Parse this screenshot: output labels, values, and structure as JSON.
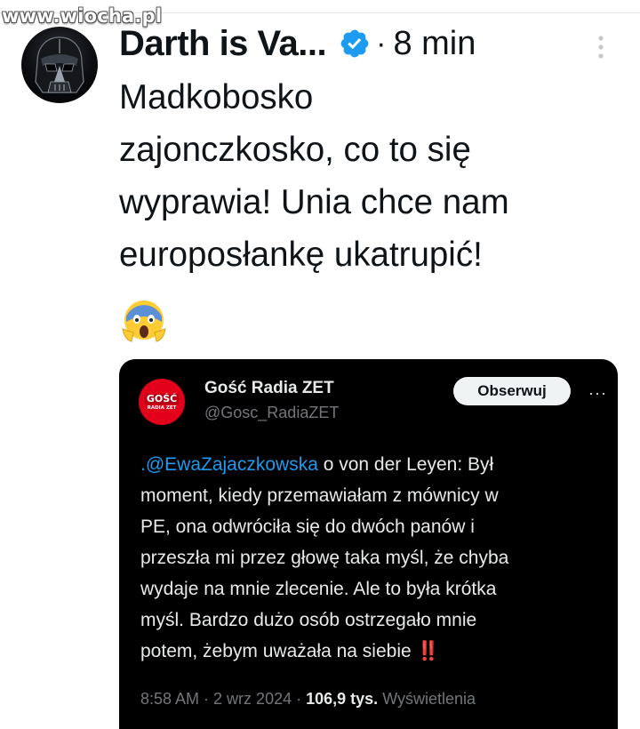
{
  "watermark": "www.wiocha.pl",
  "tweet": {
    "author_name": "Darth is Va...",
    "separator": "·",
    "time": "8 min",
    "text_lines": [
      "Madkobosko",
      "zajonczkosko, co to się",
      "wyprawia! Unia chce nam",
      "europosłankę ukatrupić!"
    ],
    "emoji": "😱"
  },
  "quoted": {
    "name": "Gość Radia ZET",
    "handle": "@Gosc_RadiaZET",
    "follow_label": "Obserwuj",
    "more": "···",
    "logo_text": "GOŚĆ",
    "logo_subtext": "RADIA ZET",
    "mention": ".@EwaZajaczkowska",
    "text_lines": [
      " o von der Leyen: Był",
      "moment, kiedy przemawiałam z mównicy w",
      "PE, ona odwróciła się do dwóch panów i",
      "przeszła mi przez głowę taka myśl, że chyba",
      "wydaje na mnie zlecenie. Ale to była krótka",
      "myśl. Bardzo dużo osób ostrzegało mnie",
      "potem, żebym uważała na siebie "
    ],
    "bangs": "‼️",
    "meta_time": "8:58 AM",
    "meta_date": "2 wrz 2024",
    "meta_sep": " · ",
    "views_count": "106,9 tys.",
    "views_label": "Wyświetlenia"
  },
  "colors": {
    "verified": "#1d9bf0",
    "mention": "#1d9bf0",
    "card_bg": "#000000",
    "logo": "#e2001a"
  },
  "icons": [
    "verified-badge-icon",
    "more-options-icon",
    "screaming-face-emoji"
  ]
}
